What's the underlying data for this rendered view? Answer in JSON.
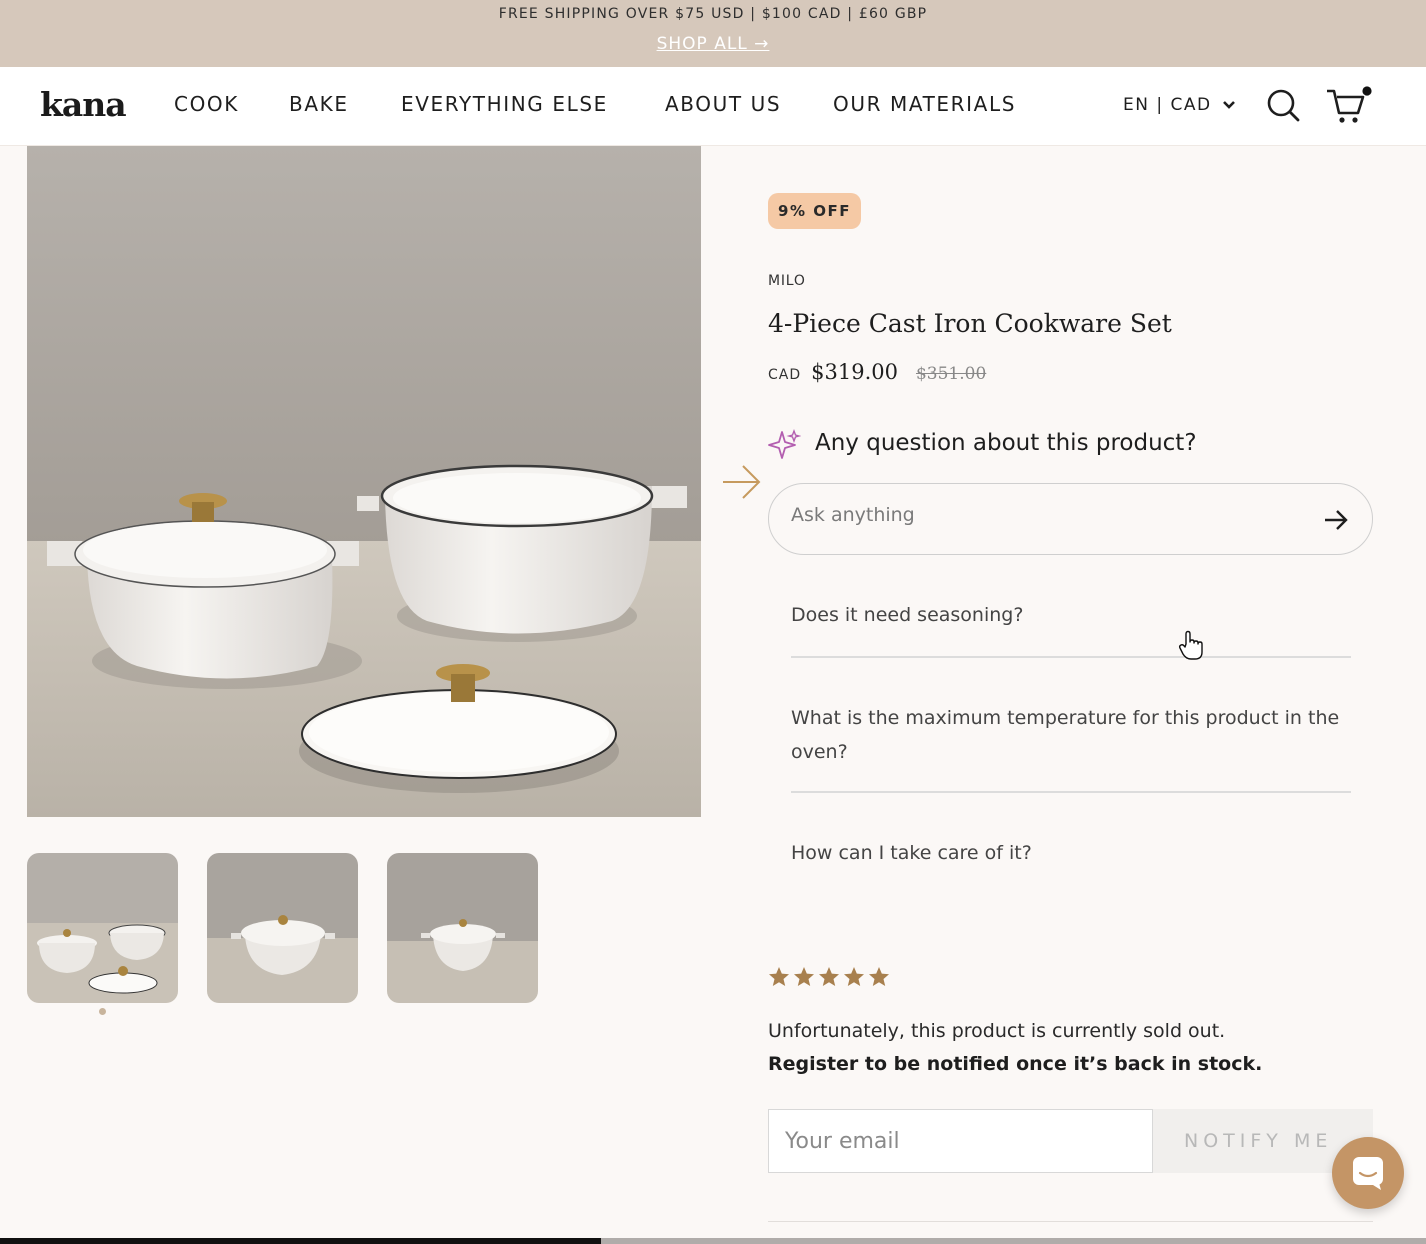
{
  "announcement": {
    "shipping": "FREE SHIPPING OVER $75 USD | $100 CAD | £60 GBP",
    "shop_all": "SHOP ALL →"
  },
  "header": {
    "logo": "kana",
    "nav": [
      "COOK",
      "BAKE",
      "EVERYTHING ELSE",
      "ABOUT US",
      "OUR MATERIALS"
    ],
    "locale": "EN | CAD",
    "icons": [
      "chevron-down-icon",
      "search-icon",
      "cart-icon"
    ]
  },
  "gallery": {
    "thumbnails": 3,
    "selected": 1
  },
  "product": {
    "badge": "9% OFF",
    "vendor": "MILO",
    "title": "4-Piece Cast Iron Cookware Set",
    "currency": "CAD",
    "price": "$319.00",
    "compare_price": "$351.00"
  },
  "ask": {
    "title": "Any question about this product?",
    "placeholder": "Ask anything",
    "suggestions": [
      "Does it need seasoning?",
      "What is the maximum temperature for this product in the oven?",
      "How can I take care of it?"
    ]
  },
  "reviews": {
    "rating": 5
  },
  "stock": {
    "soldout": "Unfortunately, this product is currently sold out.",
    "register": "Register to be notified once it’s back in stock.",
    "email_placeholder": "Your email",
    "notify_label": "NOTIFY ME"
  },
  "colors": {
    "announcement_bg": "#d6c8bb",
    "badge_bg": "#f5c9a5",
    "star": "#a8804e",
    "chat_bubble": "#c49566",
    "sparkle": "#b35fb0"
  }
}
